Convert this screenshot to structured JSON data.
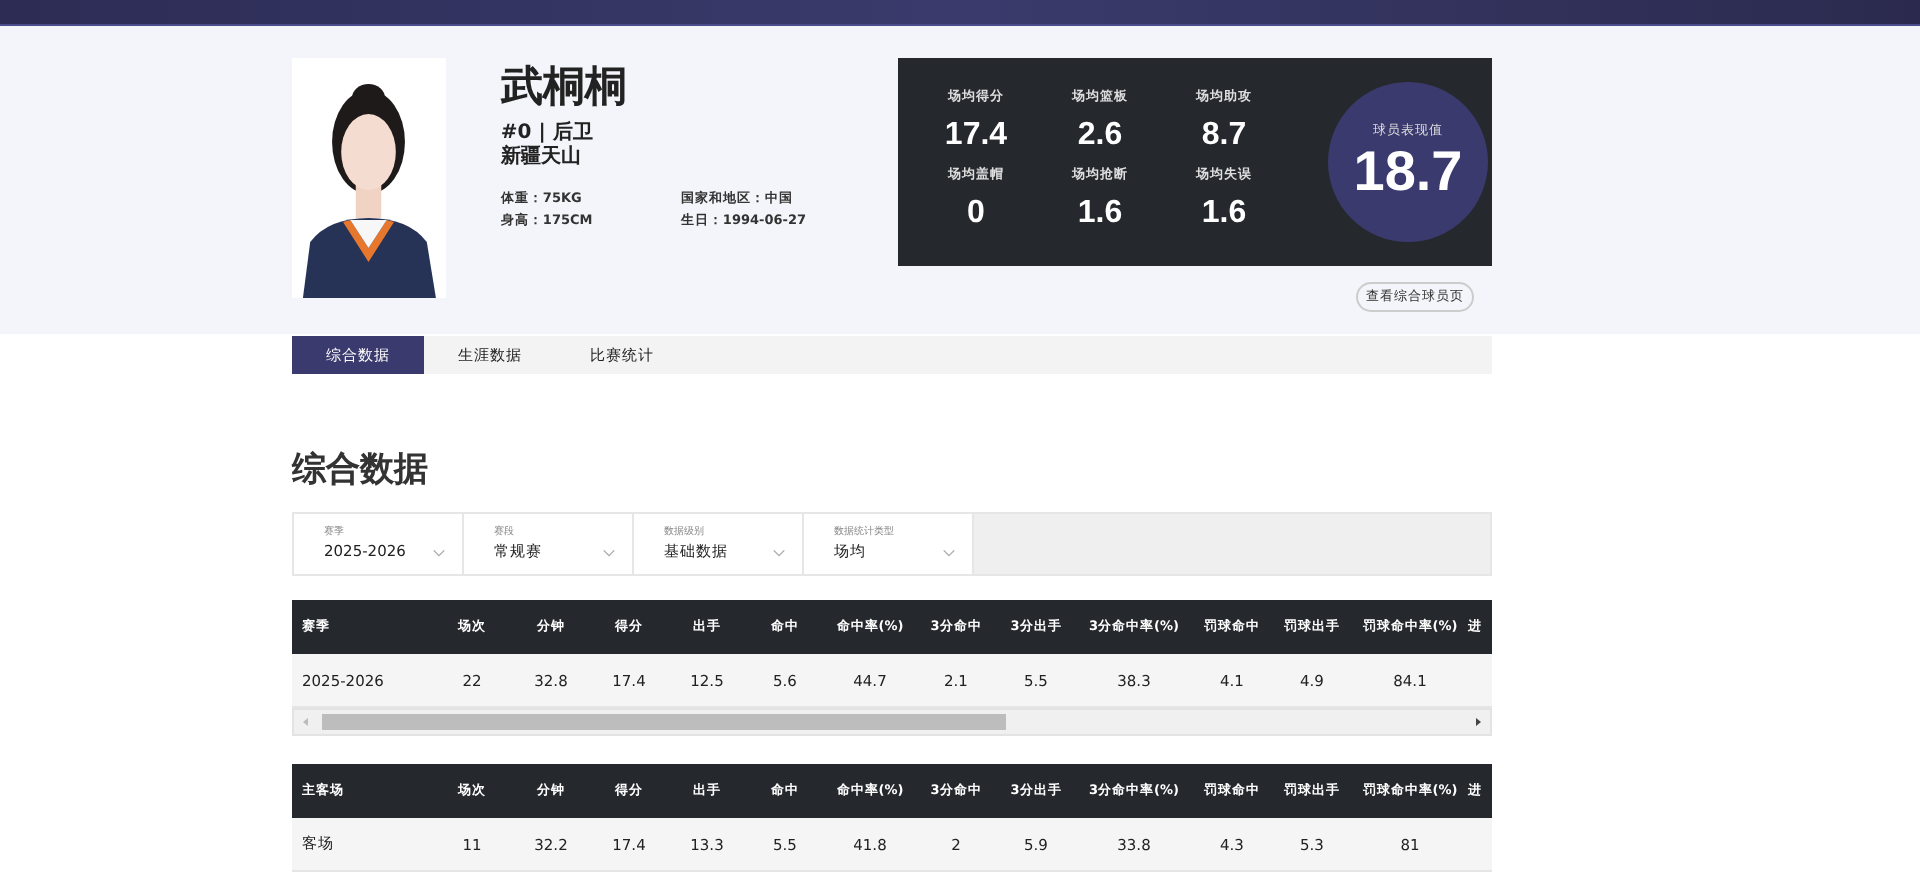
{
  "player": {
    "name": "武桐桐",
    "number_position": "#0 | 后卫",
    "team": "新疆天山",
    "info": [
      "体重：75KG",
      "国家和地区：中国",
      "身高：175CM",
      "生日：1994-06-27"
    ]
  },
  "stats": [
    {
      "label": "场均得分",
      "value": "17.4"
    },
    {
      "label": "场均篮板",
      "value": "2.6"
    },
    {
      "label": "场均助攻",
      "value": "8.7"
    },
    {
      "label": "场均盖帽",
      "value": "0"
    },
    {
      "label": "场均抢断",
      "value": "1.6"
    },
    {
      "label": "场均失误",
      "value": "1.6"
    }
  ],
  "rating": {
    "label": "球员表现值",
    "value": "18.7"
  },
  "profile_button": "查看综合球员页",
  "tabs": [
    {
      "label": "综合数据",
      "selected": true
    },
    {
      "label": "生涯数据",
      "selected": false
    },
    {
      "label": "比赛统计",
      "selected": false
    }
  ],
  "section_title": "综合数据",
  "filters": [
    {
      "label": "赛季",
      "value": "2025-2026"
    },
    {
      "label": "赛段",
      "value": "常规赛"
    },
    {
      "label": "数据级别",
      "value": "基础数据"
    },
    {
      "label": "数据统计类型",
      "value": "场均"
    }
  ],
  "tables": [
    {
      "columns": [
        "赛季",
        "场次",
        "分钟",
        "得分",
        "出手",
        "命中",
        "命中率(%)",
        "3分命中",
        "3分出手",
        "3分命中率(%)",
        "罚球命中",
        "罚球出手",
        "罚球命中率(%)",
        "进"
      ],
      "rows": [
        [
          "2025-2026",
          "22",
          "32.8",
          "17.4",
          "12.5",
          "5.6",
          "44.7",
          "2.1",
          "5.5",
          "38.3",
          "4.1",
          "4.9",
          "84.1",
          ""
        ]
      ],
      "scrollbar": true
    },
    {
      "columns": [
        "主客场",
        "场次",
        "分钟",
        "得分",
        "出手",
        "命中",
        "命中率(%)",
        "3分命中",
        "3分出手",
        "3分命中率(%)",
        "罚球命中",
        "罚球出手",
        "罚球命中率(%)",
        "进"
      ],
      "rows": [
        [
          "客场",
          "11",
          "32.2",
          "17.4",
          "13.3",
          "5.5",
          "41.8",
          "2",
          "5.9",
          "33.8",
          "4.3",
          "5.3",
          "81",
          ""
        ]
      ],
      "scrollbar": false
    }
  ]
}
